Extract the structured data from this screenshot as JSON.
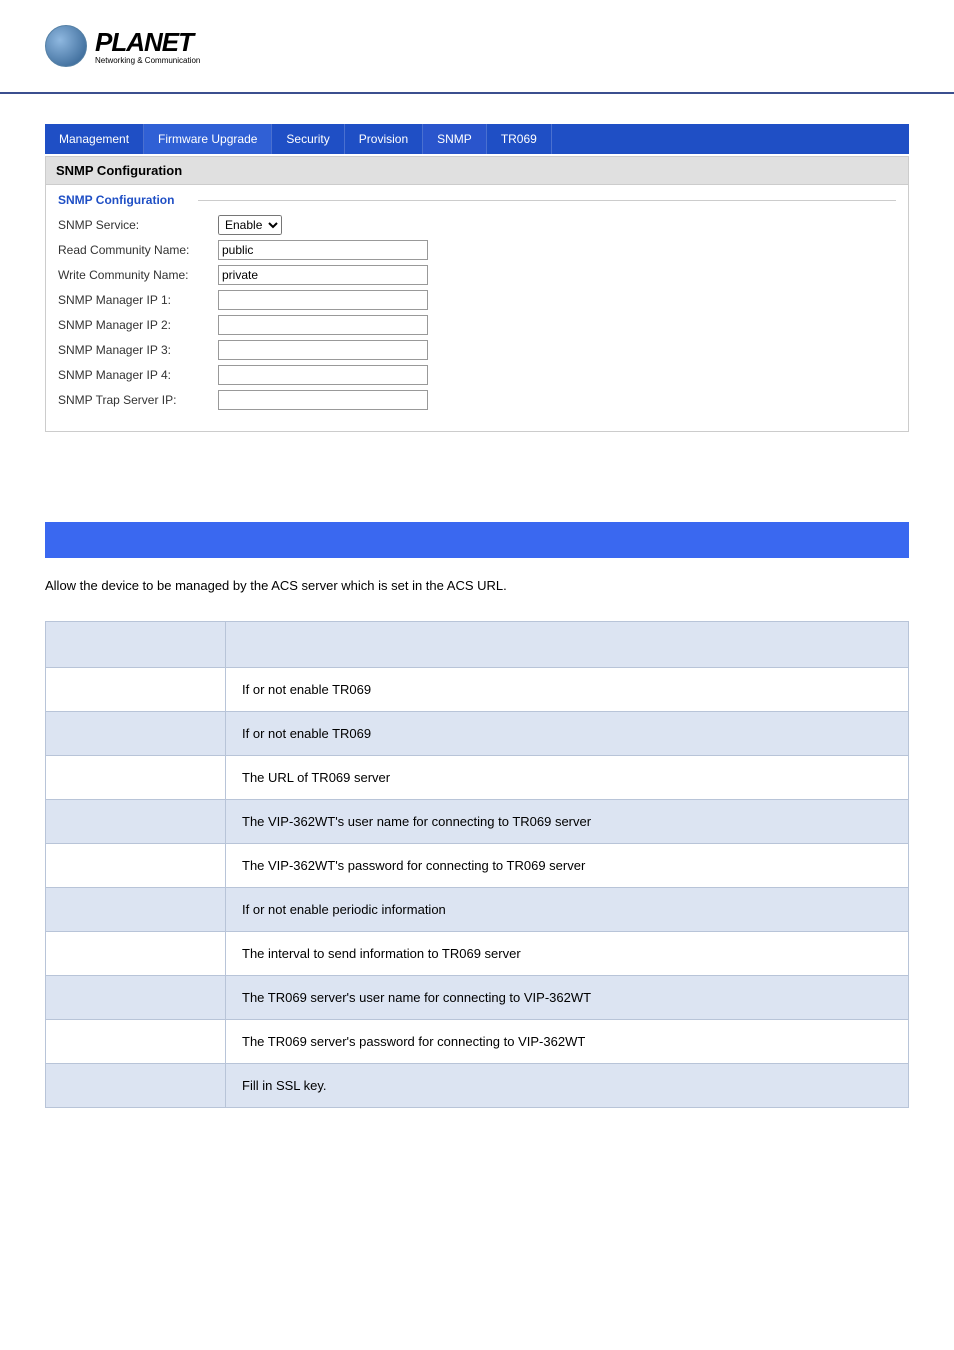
{
  "logo": {
    "brand": "PLANET",
    "tagline": "Networking & Communication"
  },
  "tabs": {
    "management": "Management",
    "firmware": "Firmware Upgrade",
    "security": "Security",
    "provision": "Provision",
    "snmp": "SNMP",
    "tr069": "TR069"
  },
  "snmp": {
    "title": "SNMP Configuration",
    "legend": "SNMP Configuration",
    "rows": {
      "service_label": "SNMP Service:",
      "service_value": "Enable",
      "read_label": "Read Community Name:",
      "read_value": "public",
      "write_label": "Write Community Name:",
      "write_value": "private",
      "mgr1_label": "SNMP Manager IP 1:",
      "mgr1_value": "",
      "mgr2_label": "SNMP Manager IP 2:",
      "mgr2_value": "",
      "mgr3_label": "SNMP Manager IP 3:",
      "mgr3_value": "",
      "mgr4_label": "SNMP Manager IP 4:",
      "mgr4_value": "",
      "trap_label": "SNMP Trap Server IP:",
      "trap_value": ""
    }
  },
  "tr069_section": {
    "desc": "Allow the device to be managed by the ACS server which is set in the ACS URL.",
    "rows": [
      "If or not enable TR069",
      "If or not enable TR069",
      "The URL of TR069 server",
      "The VIP-362WT's user name for connecting to TR069 server",
      "The VIP-362WT's password for connecting to TR069 server",
      "If or not enable periodic information",
      "The interval to send information to TR069 server",
      "The TR069 server's user name for connecting to VIP-362WT",
      "The TR069 server's password for connecting to VIP-362WT",
      "Fill in SSL key."
    ]
  }
}
